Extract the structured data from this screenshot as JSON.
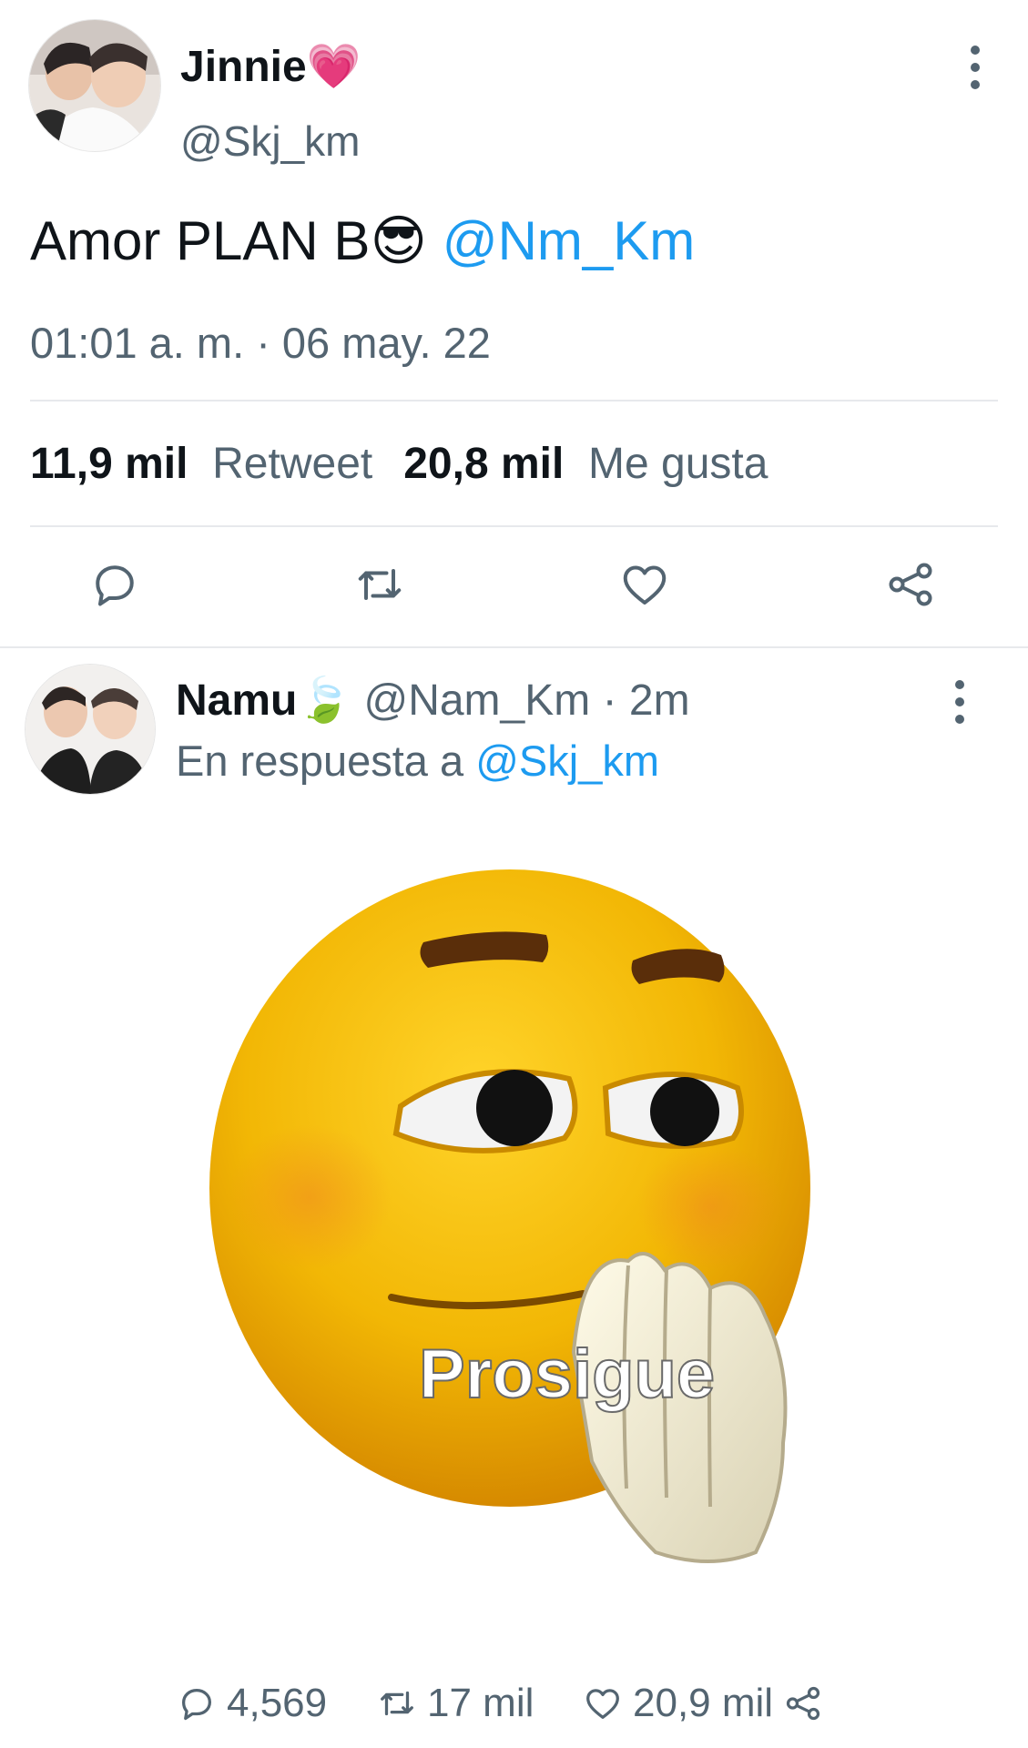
{
  "original_tweet": {
    "display_name": "Jinnie",
    "name_emoji": "💗",
    "handle": "@Skj_km",
    "text": "Amor PLAN B",
    "text_emoji": "😎",
    "mention": "@Nm_Km",
    "timestamp": "01:01 a. m. · 06 may. 22",
    "retweet_count": "11,9 mil",
    "retweet_label": "Retweet",
    "like_count": "20,8 mil",
    "like_label": "Me gusta",
    "actions": [
      "reply-icon",
      "retweet-icon",
      "heart-icon",
      "share-icon"
    ]
  },
  "reply_tweet": {
    "display_name": "Namu",
    "name_emoji": "🍃",
    "handle": "@Nam_Km",
    "separator": "·",
    "time": "2m",
    "reply_prefix": "En respuesta a",
    "reply_to": "@Skj_km",
    "image_caption": "Prosigue",
    "reply_count": "4,569",
    "retweet_count": "17 mil",
    "like_count": "20,9 mil"
  },
  "colors": {
    "link": "#1d9bf0",
    "muted": "#536471",
    "text": "#0f1419",
    "divider": "#e7e9ec",
    "emoji_yellow": "#f2b705"
  }
}
